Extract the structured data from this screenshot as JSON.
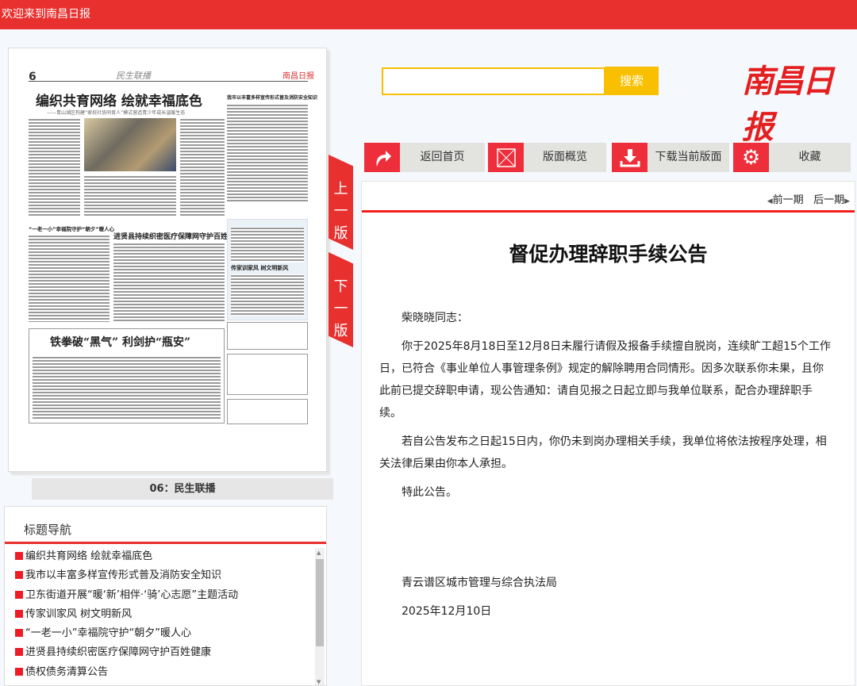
{
  "header": {
    "welcome": "欢迎来到南昌日报"
  },
  "paper": {
    "page_no": "6",
    "section": "民生联播",
    "logo": "南昌日报",
    "headlines": {
      "main": "编织共育网络  绘就幸福底色",
      "sub": "——青山湖区构建“家校社协同育人”模式营造青少年成长温暖生态",
      "a2": "“一老一小”幸福院守护“朝夕”暖人心",
      "a3": "进贤县持续织密医疗保障网守护百姓健康",
      "a4": "传家训家风  树文明新风",
      "a5": "铁拳破“黑气”  利剑护“瓶安”",
      "a6": "我市以丰富多样宣传形式普及消防安全知识"
    }
  },
  "page_tabs": {
    "prev": "上一版",
    "next": "下一版"
  },
  "caption": "06：民生联播",
  "nav": {
    "title": "标题导航",
    "items": [
      "编织共育网络 绘就幸福底色",
      "我市以丰富多样宣传形式普及消防安全知识",
      "卫东街道开展“暖‘新’相伴·‘骑’心志愿”主题活动",
      "传家训家风 树文明新风",
      "“一老一小”幸福院守护“朝夕”暖人心",
      "进贤县持续织密医疗保障网守护百姓健康",
      "债权债务清算公告"
    ]
  },
  "search": {
    "value": "",
    "button": "搜索"
  },
  "brand": "南昌日报",
  "toolbar": [
    "返回首页",
    "版面概览",
    "下载当前版面",
    "收藏"
  ],
  "issue_nav": {
    "prev": "前一期",
    "next": "后一期"
  },
  "article": {
    "title": "督促办理辞职手续公告",
    "paragraphs": [
      "柴晓晓同志：",
      "你于2025年8月18日至12月8日未履行请假及报备手续擅自脱岗，连续旷工超15个工作日，已符合《事业单位人事管理条例》规定的解除聘用合同情形。因多次联系你未果，且你此前已提交辞职申请，现公告通知：请自见报之日起立即与我单位联系，配合办理辞职手续。",
      "若自公告发布之日起15日内，你仍未到岗办理相关手续，我单位将依法按程序处理，相关法律后果由你本人承担。",
      "特此公告。"
    ],
    "signature": "青云谱区城市管理与综合执法局",
    "date": "2025年12月10日"
  },
  "colors": {
    "accent": "#e8302e",
    "search": "#f8c000"
  }
}
